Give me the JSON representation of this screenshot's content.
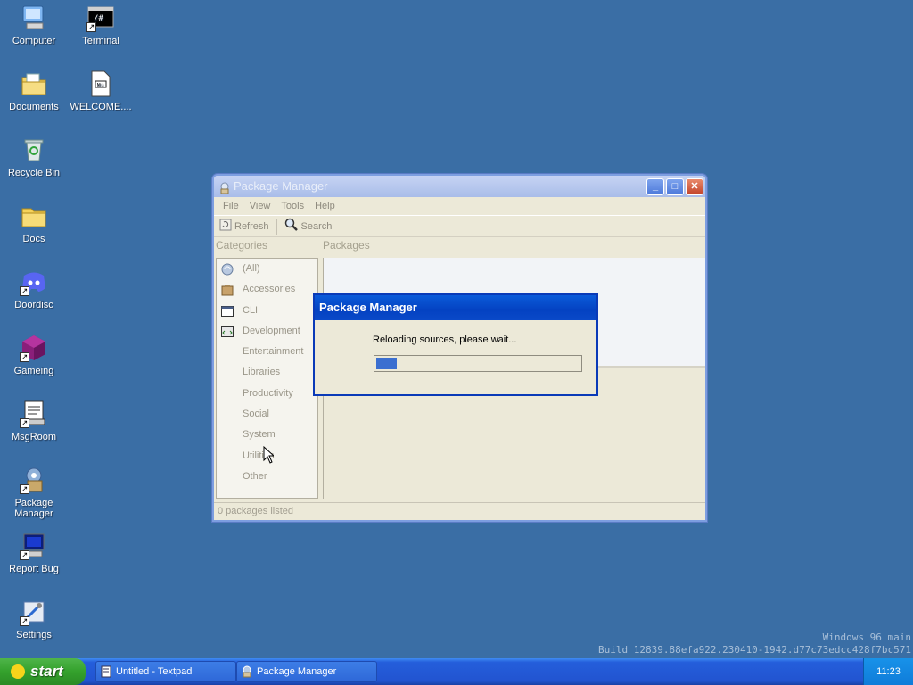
{
  "desktop": {
    "icons": [
      {
        "label": "Computer",
        "icon": "computer-icon"
      },
      {
        "label": "Terminal",
        "icon": "terminal-icon"
      },
      {
        "label": "Documents",
        "icon": "documents-folder-icon"
      },
      {
        "label": "WELCOME....",
        "icon": "document-file-icon"
      },
      {
        "label": "Recycle Bin",
        "icon": "recycle-bin-icon"
      },
      {
        "label": "Docs",
        "icon": "folder-icon"
      },
      {
        "label": "Doordisc",
        "icon": "discord-icon"
      },
      {
        "label": "Gameing",
        "icon": "game-cube-icon"
      },
      {
        "label": "MsgRoom",
        "icon": "msgroom-icon"
      },
      {
        "label": "Package Manager",
        "icon": "package-manager-icon"
      },
      {
        "label": "Report Bug",
        "icon": "report-bug-icon"
      },
      {
        "label": "Settings",
        "icon": "settings-icon"
      }
    ],
    "watermark": {
      "line1": "Windows 96 main",
      "line2": "Build 12839.88efa922.230410-1942.d77c73edcc428f7bc571"
    }
  },
  "window": {
    "title": "Package Manager",
    "menu": [
      "File",
      "View",
      "Tools",
      "Help"
    ],
    "toolbar": {
      "refresh": "Refresh",
      "search": "Search"
    },
    "categories_label": "Categories",
    "packages_label": "Packages",
    "categories": [
      "(All)",
      "Accessories",
      "CLI",
      "Development",
      "Entertainment",
      "Libraries",
      "Productivity",
      "Social",
      "System",
      "Utilities",
      "Other"
    ],
    "status": "0 packages listed"
  },
  "dialog": {
    "title": "Package Manager",
    "message": "Reloading sources, please wait...",
    "progress": 0.1
  },
  "taskbar": {
    "start": "start",
    "tasks": [
      "Untitled - Textpad",
      "Package Manager"
    ],
    "clock": "11:23"
  }
}
